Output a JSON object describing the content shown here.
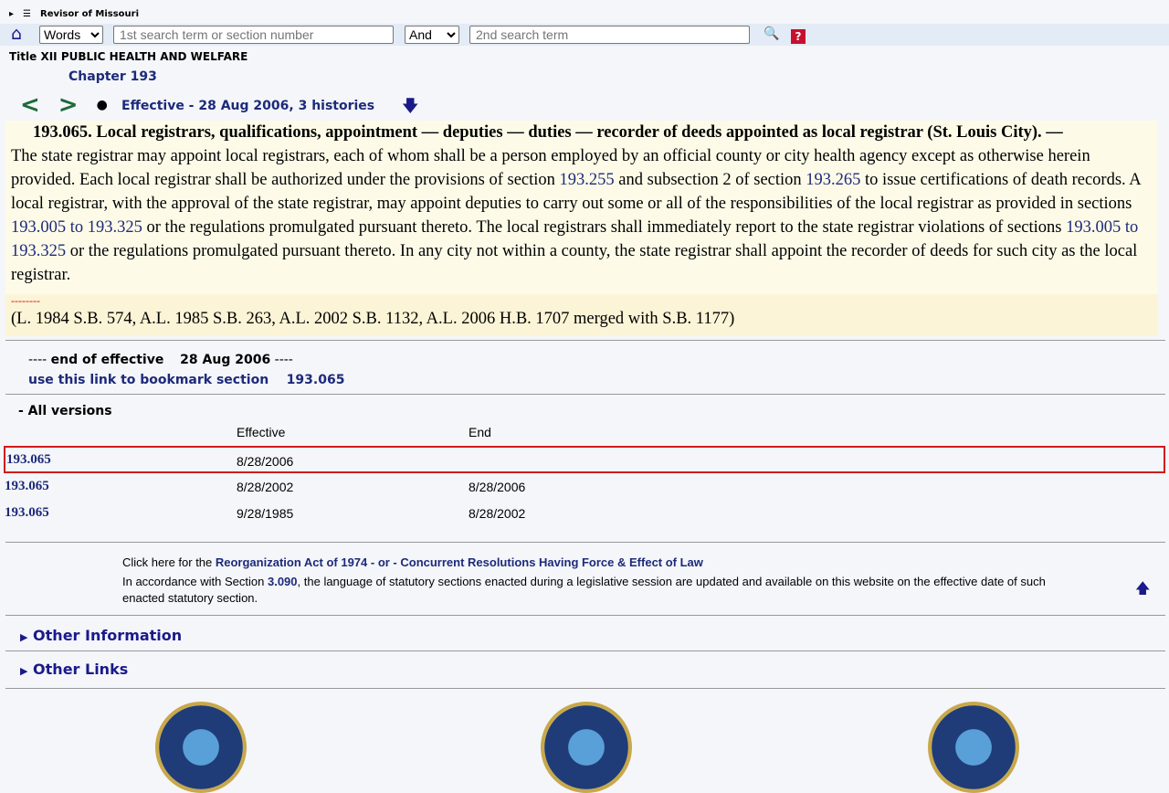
{
  "header": {
    "site": "Revisor of Missouri",
    "search_type": "Words",
    "search1_placeholder": "1st search term or section number",
    "operator": "And",
    "search2_placeholder": "2nd search term",
    "help": "?"
  },
  "title": "Title XII PUBLIC HEALTH AND WELFARE",
  "chapter": "Chapter 193",
  "nav": {
    "prev": "<",
    "next": ">",
    "dot": "●",
    "effective": "Effective - 28 Aug 2006, 3 histories"
  },
  "statute": {
    "heading": "193.065.  Local registrars, qualifications, appointment — deputies — duties — recorder of deeds appointed as local registrar (St. Louis City). —",
    "p1": "The state registrar may appoint local registrars, each of whom shall be a person employed by an official county or city health agency except as otherwise herein provided.  Each local registrar shall be authorized under the provisions of section ",
    "l1": "193.255",
    "p2": " and subsection 2 of section ",
    "l2": "193.265",
    "p3": " to issue certifications of death records.  A local registrar, with the approval of the state registrar, may appoint deputies to carry out some or all of the responsibilities of the local registrar as provided in sections ",
    "l3": "193.005 to 193.325",
    "p4": " or the regulations promulgated pursuant thereto.  The local registrars shall immediately report to the state registrar violations of sections ",
    "l4": "193.005 to 193.325",
    "p5": " or the regulations promulgated pursuant thereto.  In any city not within a county, the state registrar shall appoint the recorder of deeds for such city as the local registrar.",
    "dashes": "--------",
    "history": "(L. 1984 S.B. 574, A.L. 1985 S.B. 263, A.L. 2002 S.B. 1132, A.L. 2006 H.B. 1707 merged with S.B. 1177)"
  },
  "end": {
    "prefix": "---- ",
    "label": "end of effective",
    "date": "28 Aug 2006",
    "suffix": " ----",
    "bookmark": "use this link to bookmark section",
    "section": "193.065"
  },
  "versions": {
    "title": "- All versions",
    "col_effective": "Effective",
    "col_end": "End",
    "rows": [
      {
        "section": "193.065",
        "effective": "8/28/2006",
        "end": ""
      },
      {
        "section": "193.065",
        "effective": "8/28/2002",
        "end": "8/28/2006"
      },
      {
        "section": "193.065",
        "effective": "9/28/1985",
        "end": "8/28/2002"
      }
    ]
  },
  "footer": {
    "click": "Click here for the ",
    "reorg": "Reorganization Act of 1974 - or - Concurrent Resolutions Having Force & Effect of Law",
    "acc1": "In accordance with Section ",
    "sec": "3.090",
    "acc2": ", the language of statutory sections enacted during a legislative session are updated and available on this website on the effective date of such enacted statutory section.",
    "other_info": "Other Information",
    "other_links": "Other Links"
  }
}
